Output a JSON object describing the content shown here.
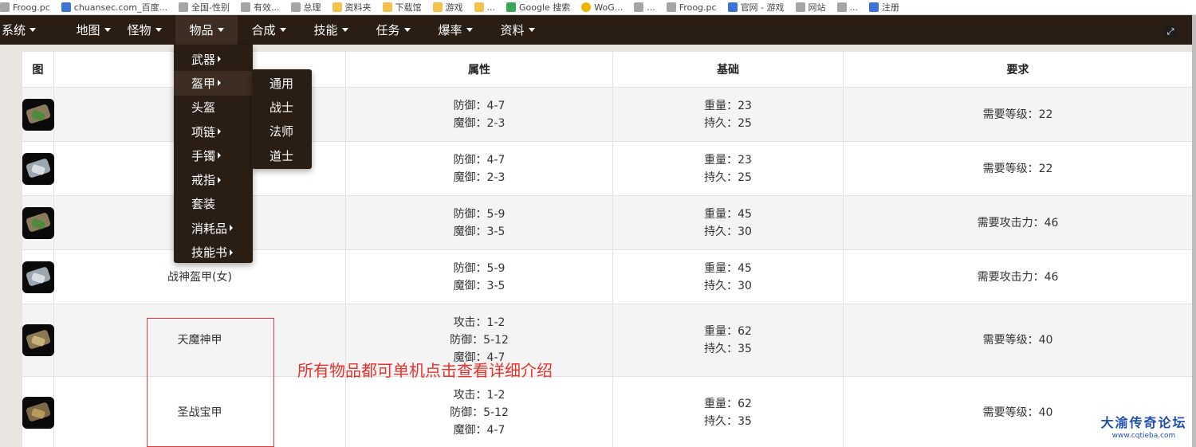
{
  "bookmarks": [
    "Froog.pc",
    "chuansec.com_百度...",
    "全国-性别",
    "有效...",
    "总理",
    "资料夹",
    "下载馆",
    "游戏",
    "...",
    "Google 搜索",
    "WoG...",
    "...",
    "Froog.pc",
    "官网 - 游戏",
    "网站",
    "...",
    "注册"
  ],
  "nav": {
    "items": [
      {
        "label": "系统"
      },
      {
        "label": "地图"
      },
      {
        "label": "怪物"
      },
      {
        "label": "物品"
      },
      {
        "label": "合成"
      },
      {
        "label": "技能"
      },
      {
        "label": "任务"
      },
      {
        "label": "爆率"
      },
      {
        "label": "资料"
      }
    ],
    "active_index": 3
  },
  "dropdown": {
    "items": [
      {
        "label": "武器",
        "has_sub": true
      },
      {
        "label": "盔甲",
        "has_sub": true
      },
      {
        "label": "头盔",
        "has_sub": false
      },
      {
        "label": "项链",
        "has_sub": true
      },
      {
        "label": "手镯",
        "has_sub": true
      },
      {
        "label": "戒指",
        "has_sub": true
      },
      {
        "label": "套装",
        "has_sub": false
      },
      {
        "label": "消耗品",
        "has_sub": true
      },
      {
        "label": "技能书",
        "has_sub": true
      }
    ],
    "active_index": 1
  },
  "submenu": {
    "items": [
      {
        "label": "通用"
      },
      {
        "label": "战士"
      },
      {
        "label": "法师"
      },
      {
        "label": "道士"
      }
    ]
  },
  "table": {
    "headers": [
      "图",
      "",
      "属性",
      "基础",
      "要求"
    ],
    "rows": [
      {
        "icon": "armor-green-icon",
        "name": "",
        "attrs": [
          "防御：4-7",
          "魔御：2-3"
        ],
        "base": [
          "重量：23",
          "持久：25"
        ],
        "req": "需要等级：22"
      },
      {
        "icon": "armor-silver-icon",
        "name": "",
        "attrs": [
          "防御：4-7",
          "魔御：2-3"
        ],
        "base": [
          "重量：23",
          "持久：25"
        ],
        "req": "需要等级：22"
      },
      {
        "icon": "armor-green-icon",
        "name": "战",
        "attrs": [
          "防御：5-9",
          "魔御：3-5"
        ],
        "base": [
          "重量：45",
          "持久：30"
        ],
        "req": "需要攻击力：46"
      },
      {
        "icon": "armor-silver-icon",
        "name": "战神盔甲(女)",
        "attrs": [
          "防御：5-9",
          "魔御：3-5"
        ],
        "base": [
          "重量：45",
          "持久：30"
        ],
        "req": "需要攻击力：46"
      },
      {
        "icon": "armor-gold-icon",
        "name": "天魔神甲",
        "attrs": [
          "攻击：1-2",
          "防御：5-12",
          "魔御：4-7"
        ],
        "base": [
          "重量：62",
          "持久：35"
        ],
        "req": "需要等级：40"
      },
      {
        "icon": "armor-dark-icon",
        "name": "圣战宝甲",
        "attrs": [
          "攻击：1-2",
          "防御：5-12",
          "魔御：4-7"
        ],
        "base": [
          "重量：62",
          "持久：35"
        ],
        "req": "需要等级：40"
      }
    ]
  },
  "annotation": {
    "text": "所有物品都可单机点击查看详细介绍"
  },
  "watermark": {
    "title": "大渝传奇论坛",
    "url": "www.cqtieba.com"
  },
  "colors": {
    "navbar": "#2a1d14",
    "nav_active": "#3d2d22",
    "annotation_red": "#e8332c",
    "watermark_blue": "#1f4fb0"
  }
}
